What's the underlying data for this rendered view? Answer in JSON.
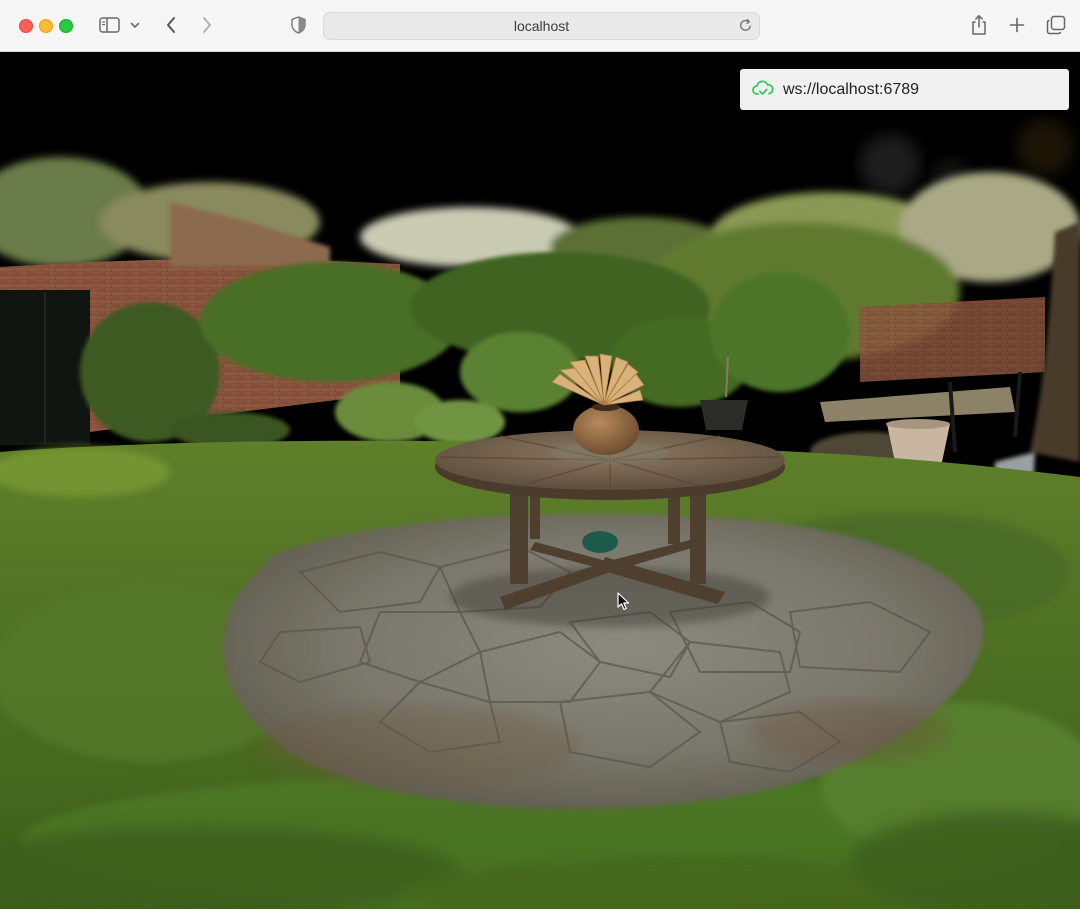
{
  "browser": {
    "url": "localhost",
    "icons": [
      "sidebar-icon",
      "chevron-down-icon",
      "back-icon",
      "forward-icon",
      "shield-icon",
      "reload-icon",
      "share-icon",
      "new-tab-icon",
      "tabs-overview-icon"
    ]
  },
  "viewer": {
    "connection": {
      "address": "ws://localhost:6789",
      "status_icon": "cloud-connected-icon",
      "status_color": "#34c759"
    },
    "scene": "3d-gaussian-splat-garden"
  }
}
